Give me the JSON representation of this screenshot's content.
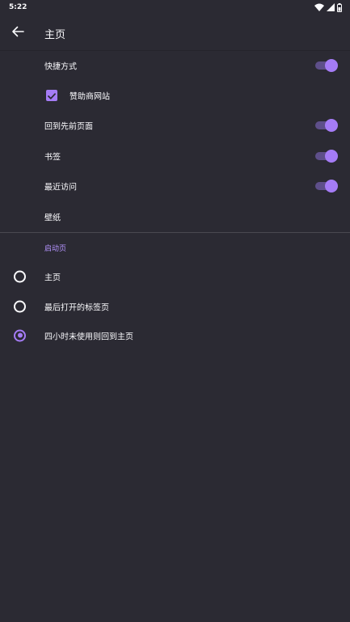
{
  "status_bar": {
    "time": "5:22",
    "icons": [
      "wifi-icon",
      "cell-signal-icon",
      "battery-icon"
    ]
  },
  "app_bar": {
    "back_icon": "arrow-left-icon",
    "title": "主页"
  },
  "settings": {
    "shortcuts": {
      "label": "快捷方式",
      "enabled": true
    },
    "sponsored_sites": {
      "label": "赞助商网站",
      "checked": true
    },
    "jump_back_in": {
      "label": "回到先前页面",
      "enabled": true
    },
    "bookmarks": {
      "label": "书签",
      "enabled": true
    },
    "recent_visits": {
      "label": "最近访问",
      "enabled": true
    },
    "wallpaper": {
      "label": "壁纸"
    }
  },
  "opening_screen": {
    "header": "启动页",
    "options": [
      {
        "label": "主页",
        "selected": false
      },
      {
        "label": "最后打开的标签页",
        "selected": false
      },
      {
        "label": "四小时未使用则回到主页",
        "selected": true
      }
    ]
  },
  "colors": {
    "background": "#2b2a33",
    "accent": "#a57cf6",
    "accent_track": "#5e4f8a",
    "text": "#fbfbfe",
    "section_header": "#b594ff"
  }
}
